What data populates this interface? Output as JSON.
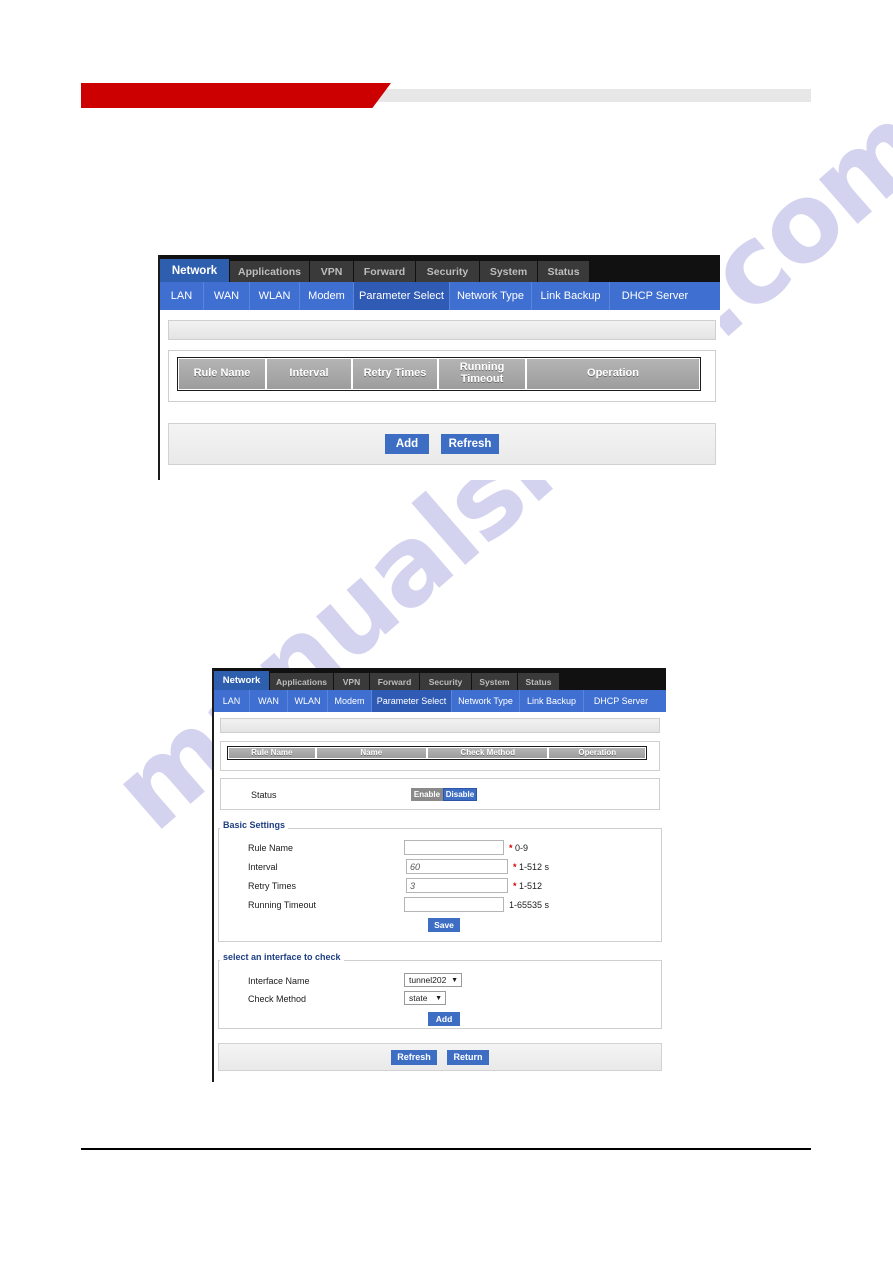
{
  "header": {
    "banner_red_color": "#cc0000",
    "banner_gray_color": "#e7e7e7"
  },
  "watermark": {
    "text": "manualshive.com",
    "color": "#b9b9e6"
  },
  "screenshot_one": {
    "nav_tabs": [
      {
        "label": "Network",
        "active": true
      },
      {
        "label": "Applications",
        "active": false
      },
      {
        "label": "VPN",
        "active": false
      },
      {
        "label": "Forward",
        "active": false
      },
      {
        "label": "Security",
        "active": false
      },
      {
        "label": "System",
        "active": false
      },
      {
        "label": "Status",
        "active": false
      }
    ],
    "sub_tabs": [
      {
        "label": "LAN",
        "active": false
      },
      {
        "label": "WAN",
        "active": false
      },
      {
        "label": "WLAN",
        "active": false
      },
      {
        "label": "Modem",
        "active": false
      },
      {
        "label": "Parameter Select",
        "active": true
      },
      {
        "label": "Network Type",
        "active": false
      },
      {
        "label": "Link Backup",
        "active": false
      },
      {
        "label": "DHCP Server",
        "active": false
      }
    ],
    "breadcrumb": "",
    "table": {
      "columns": [
        "Rule Name",
        "Interval",
        "Retry Times",
        "Running\nTimeout",
        "Operation"
      ],
      "rows": []
    },
    "buttons": [
      {
        "label": "Add"
      },
      {
        "label": "Refresh"
      }
    ]
  },
  "screenshot_two": {
    "nav_tabs": [
      {
        "label": "Network",
        "active": true
      },
      {
        "label": "Applications",
        "active": false
      },
      {
        "label": "VPN",
        "active": false
      },
      {
        "label": "Forward",
        "active": false
      },
      {
        "label": "Security",
        "active": false
      },
      {
        "label": "System",
        "active": false
      },
      {
        "label": "Status",
        "active": false
      }
    ],
    "sub_tabs": [
      {
        "label": "LAN",
        "active": false
      },
      {
        "label": "WAN",
        "active": false
      },
      {
        "label": "WLAN",
        "active": false
      },
      {
        "label": "Modem",
        "active": false
      },
      {
        "label": "Parameter Select",
        "active": true
      },
      {
        "label": "Network Type",
        "active": false
      },
      {
        "label": "Link Backup",
        "active": false
      },
      {
        "label": "DHCP Server",
        "active": false
      }
    ],
    "breadcrumb": "",
    "table": {
      "columns": [
        "Rule Name",
        "Name",
        "Check Method",
        "Operation"
      ],
      "rows": []
    },
    "status_row": {
      "label": "Status",
      "options": [
        {
          "label": "Enable",
          "selected": false
        },
        {
          "label": "Disable",
          "selected": true
        }
      ]
    },
    "basic_settings": {
      "title": "Basic Settings",
      "fields": [
        {
          "label": "Rule Name",
          "value": "",
          "required": true,
          "hint": "0-9"
        },
        {
          "label": "Interval",
          "value": "60",
          "required": true,
          "hint": "1-512 s"
        },
        {
          "label": "Retry Times",
          "value": "3",
          "required": true,
          "hint": "1-512"
        },
        {
          "label": "Running Timeout",
          "value": "",
          "required": false,
          "hint": "1-65535 s"
        }
      ],
      "save_label": "Save"
    },
    "interface_check": {
      "title": "select an interface to check",
      "interface_label": "Interface Name",
      "interface_value": "tunnel202",
      "method_label": "Check Method",
      "method_value": "state",
      "add_label": "Add"
    },
    "footer_buttons": [
      {
        "label": "Refresh"
      },
      {
        "label": "Return"
      }
    ]
  }
}
